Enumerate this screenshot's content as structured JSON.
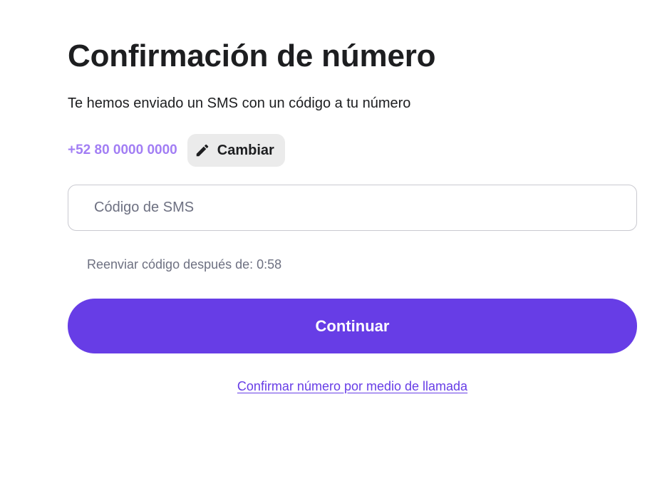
{
  "page": {
    "title": "Confirmación de número",
    "subtitle": "Te hemos enviado un SMS con un código a tu número"
  },
  "phone": {
    "number": "+52 80 0000 0000",
    "change_label": "Cambiar",
    "change_icon": "pencil-icon"
  },
  "sms_input": {
    "placeholder": "Código de SMS",
    "value": ""
  },
  "resend": {
    "text": "Reenviar código después de: 0:58"
  },
  "actions": {
    "continue_label": "Continuar",
    "call_link_label": "Confirmar número por medio de llamada"
  },
  "colors": {
    "primary": "#673de6",
    "phone_accent": "#a27ef4",
    "text": "#1d1e20",
    "muted": "#6d7081",
    "chip_bg": "#ebebeb"
  }
}
